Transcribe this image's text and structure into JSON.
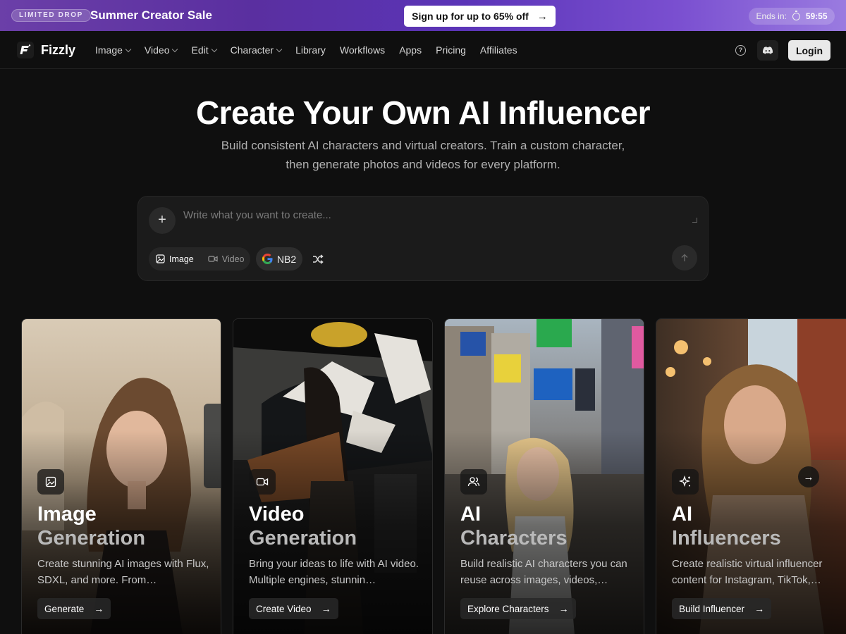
{
  "promo": {
    "badge": "LIMITED DROP",
    "title": "Summer Creator Sale",
    "cta_label": "Sign up for up to 65% off",
    "timer_label": "Ends in:",
    "timer_value": "59:55"
  },
  "nav": {
    "brand": "Fizzly",
    "items": [
      {
        "label": "Image",
        "dropdown": true
      },
      {
        "label": "Video",
        "dropdown": true
      },
      {
        "label": "Edit",
        "dropdown": true
      },
      {
        "label": "Character",
        "dropdown": true
      },
      {
        "label": "Library",
        "dropdown": false
      },
      {
        "label": "Workflows",
        "dropdown": false
      },
      {
        "label": "Apps",
        "dropdown": false
      },
      {
        "label": "Pricing",
        "dropdown": false
      },
      {
        "label": "Affiliates",
        "dropdown": false
      }
    ],
    "login_label": "Login",
    "help_icon": "question-circle-icon",
    "discord_icon": "discord-icon"
  },
  "hero": {
    "title": "Create Your Own AI Influencer",
    "subtitle_line1": "Build consistent AI characters and virtual creators. Train a custom character,",
    "subtitle_line2": "then generate photos and videos for every platform."
  },
  "prompt": {
    "placeholder": "Write what you want to create...",
    "mode_image": "Image",
    "mode_video": "Video",
    "active_mode": "Image",
    "model": "NB2"
  },
  "cards": [
    {
      "title1": "Image",
      "title2": "Generation",
      "desc": "Create stunning AI images with Flux, SDXL, and more. From…",
      "button": "Generate",
      "icon": "image-icon"
    },
    {
      "title1": "Video",
      "title2": "Generation",
      "desc": "Bring your ideas to life with AI video. Multiple engines, stunnin…",
      "button": "Create Video",
      "icon": "video-icon"
    },
    {
      "title1": "AI",
      "title2": "Characters",
      "desc": "Build realistic AI characters you can reuse across images, videos,…",
      "button": "Explore Characters",
      "icon": "users-icon"
    },
    {
      "title1": "AI",
      "title2": "Influencers",
      "desc": "Create realistic virtual influencer content for Instagram, TikTok,…",
      "button": "Build Influencer",
      "icon": "sparkles-icon"
    }
  ],
  "colors": {
    "banner_gradient_start": "#6b3fa8",
    "banner_gradient_end": "#9a7be0",
    "page_bg": "#0f0f0f",
    "panel_bg": "#1b1b1b"
  }
}
